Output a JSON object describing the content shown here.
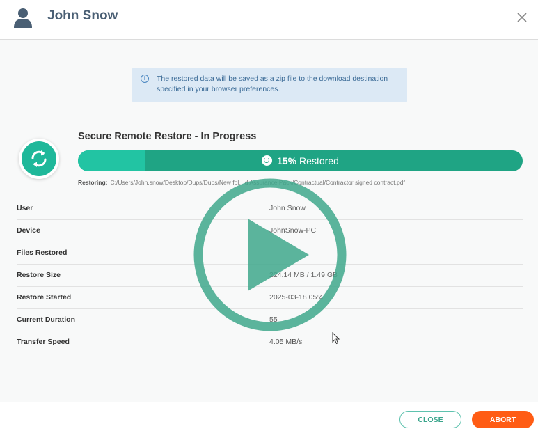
{
  "header": {
    "title": "John Snow",
    "avatar_icon": "user-silhouette-icon",
    "close_icon": "close-icon"
  },
  "info_banner": {
    "icon": "info-icon",
    "icon_glyph": "i",
    "line1": "The restored data will be saved as a zip file to the download destination",
    "line2": "specified in your browser preferences."
  },
  "restore": {
    "icon": "sync-icon",
    "title": "Secure Remote Restore - In Progress",
    "progress_percent": 15,
    "progress_value": "15%",
    "progress_suffix": "Restored",
    "restoring_label": "Restoring:",
    "restoring_path": "C:/Users/John.snow/Desktop/Dups/Dups/New fol…d Assurance Pack/Contractual/Contractor signed contract.pdf"
  },
  "details": [
    {
      "label": "User",
      "value": "John Snow"
    },
    {
      "label": "Device",
      "value": "JohnSnow-PC"
    },
    {
      "label": "Files Restored",
      "value": ""
    },
    {
      "label": "Restore Size",
      "value": "224.14 MB / 1.49 GB"
    },
    {
      "label": "Restore Started",
      "value": "2025-03-18 05:4"
    },
    {
      "label": "Current Duration",
      "value": "55"
    },
    {
      "label": "Transfer Speed",
      "value": "4.05 MB/s"
    }
  ],
  "overlay": {
    "icon": "play-icon"
  },
  "footer": {
    "close_label": "CLOSE",
    "abort_label": "ABORT"
  },
  "colors": {
    "accent": "#1fa484",
    "accent_light": "#22c4a3",
    "abort": "#ff5c14",
    "banner_bg": "#dce9f5",
    "header_text": "#4a5f74"
  }
}
